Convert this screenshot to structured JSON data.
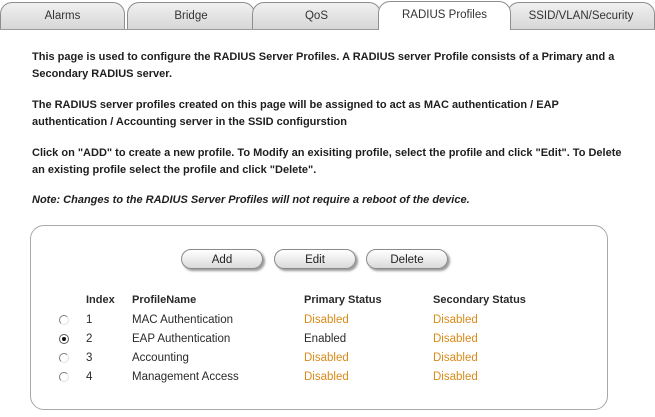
{
  "tabs": [
    {
      "label": "Alarms",
      "active": false
    },
    {
      "label": "Bridge",
      "active": false
    },
    {
      "label": "QoS",
      "active": false
    },
    {
      "label": "RADIUS Profiles",
      "active": true
    },
    {
      "label": "SSID/VLAN/Security",
      "active": false
    }
  ],
  "description": {
    "p1": "This page is used to configure the RADIUS Server Profiles. A RADIUS server Profile consists of a Primary and a Secondary RADIUS server.",
    "p2": "The RADIUS server profiles created on this page will be assigned to act as MAC authentication / EAP authentication / Accounting server in the SSID configurstion",
    "p3": "Click on \"ADD\" to create a new profile. To Modify an exisiting profile, select the profile and click \"Edit\". To Delete an existing profile select the profile and click \"Delete\".",
    "note": "Note: Changes to the RADIUS Server Profiles will not require a reboot of the device."
  },
  "buttons": {
    "add": "Add",
    "edit": "Edit",
    "delete": "Delete"
  },
  "table": {
    "headers": {
      "index": "Index",
      "profile_name": "ProfileName",
      "primary_status": "Primary Status",
      "secondary_status": "Secondary Status"
    },
    "rows": [
      {
        "index": "1",
        "name": "MAC Authentication",
        "primary": "Disabled",
        "secondary": "Disabled",
        "selected": false
      },
      {
        "index": "2",
        "name": "EAP Authentication",
        "primary": "Enabled",
        "secondary": "Disabled",
        "selected": true
      },
      {
        "index": "3",
        "name": "Accounting",
        "primary": "Disabled",
        "secondary": "Disabled",
        "selected": false
      },
      {
        "index": "4",
        "name": "Management Access",
        "primary": "Disabled",
        "secondary": "Disabled",
        "selected": false
      }
    ]
  },
  "colors": {
    "disabled": "#d98b18",
    "enabled": "#2a2a2a"
  }
}
